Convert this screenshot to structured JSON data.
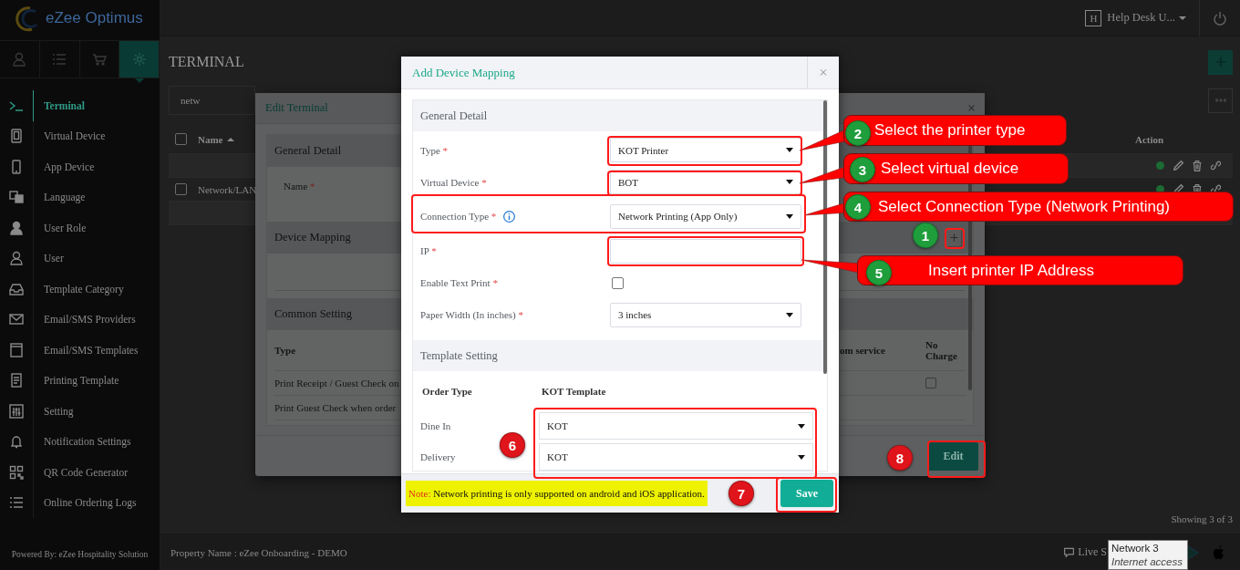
{
  "header": {
    "logo": "eZee Optimus",
    "user_badge": "H",
    "user_name": "Help Desk U..."
  },
  "nav_tabs": [
    {
      "kind": "user",
      "selected": false
    },
    {
      "kind": "list",
      "selected": false
    },
    {
      "kind": "cart",
      "selected": false
    },
    {
      "kind": "gear",
      "selected": true
    }
  ],
  "sidebar": {
    "items": [
      {
        "kind": "terminal",
        "label": "Terminal",
        "selected": true
      },
      {
        "kind": "tablet",
        "label": "Virtual Device",
        "selected": false
      },
      {
        "kind": "phone",
        "label": "App Device",
        "selected": false
      },
      {
        "kind": "language",
        "label": "Language",
        "selected": false
      },
      {
        "kind": "role",
        "label": "User Role",
        "selected": false
      },
      {
        "kind": "user",
        "label": "User",
        "selected": false
      },
      {
        "kind": "tray",
        "label": "Template Category",
        "selected": false
      },
      {
        "kind": "mail",
        "label": "Email/SMS Providers",
        "selected": false
      },
      {
        "kind": "window",
        "label": "Email/SMS Templates",
        "selected": false
      },
      {
        "kind": "doc",
        "label": "Printing Template",
        "selected": false
      },
      {
        "kind": "sliders",
        "label": "Setting",
        "selected": false
      },
      {
        "kind": "bell",
        "label": "Notification Settings",
        "selected": false
      },
      {
        "kind": "qr",
        "label": "QR Code Generator",
        "selected": false
      },
      {
        "kind": "list",
        "label": "Online Ordering Logs",
        "selected": false
      }
    ],
    "footer": "Powered By: eZee Hospitality Solution"
  },
  "page": {
    "title": "TERMINAL",
    "search_value": "netw",
    "select_all_checked": false,
    "columns": [
      "Name",
      "Action"
    ],
    "rows": [
      {
        "kind": "striped",
        "actions": true
      },
      {
        "kind": "text",
        "name": "Network/LAN",
        "checked": false,
        "actions": true
      },
      {
        "kind": "striped"
      }
    ],
    "showing": "Showing 3 of 3"
  },
  "footer": {
    "property": "Property Name : eZee Onboarding - DEMO",
    "live": "Live S"
  },
  "tooltip": {
    "title": "Network 3",
    "subtitle": "Internet access"
  },
  "edit_terminal": {
    "title": "Edit Terminal",
    "close": "×",
    "sections": [
      "General Detail",
      "Device Mapping",
      "Common Setting"
    ],
    "name_label": "Name",
    "name_required_mark": "*",
    "common_columns": [
      "Type",
      "om service",
      "No Charge"
    ],
    "common_rows": [
      {
        "type": "Print Receipt / Guest Check on",
        "no_charge": false
      },
      {
        "type": "Print Guest Check when order"
      }
    ],
    "edit": "Edit"
  },
  "add_device_mapping": {
    "title": "Add Device Mapping",
    "close": "×",
    "general_title": "General Detail",
    "fields": [
      {
        "kind": "select",
        "label": "Type",
        "required_mark": "*",
        "value": "KOT Printer"
      },
      {
        "kind": "select",
        "label": "Virtual Device",
        "required_mark": "*",
        "value": "BOT"
      },
      {
        "kind": "select",
        "label": "Connection Type",
        "required_mark": "*",
        "info": true,
        "value": "Network Printing (App Only)"
      },
      {
        "kind": "text",
        "label": "IP",
        "required_mark": "*"
      },
      {
        "kind": "checkbox",
        "label": "Enable Text Print",
        "required_mark": "*",
        "checked": false
      },
      {
        "kind": "select",
        "label": "Paper Width (In inches)",
        "required_mark": "*",
        "value": "3 inches"
      }
    ],
    "template_title": "Template Setting",
    "template_columns": [
      "Order Type",
      "KOT Template"
    ],
    "templates": [
      {
        "order_type": "Dine In",
        "value": "KOT"
      },
      {
        "order_type": "Delivery",
        "value": "KOT"
      }
    ],
    "note_label": "Note:",
    "note": "Network printing is only supported on android and iOS application.",
    "save": "Save"
  },
  "callouts": [
    {
      "number": "2",
      "text": "Select the printer type"
    },
    {
      "number": "3",
      "text": "Select virtual device"
    },
    {
      "number": "4",
      "text": "Select Connection Type (Network Printing)"
    },
    {
      "number": "5",
      "text": "Insert printer IP Address"
    }
  ],
  "markers": [
    {
      "number": "1",
      "color": "#1f9e3c"
    },
    {
      "number": "6",
      "color": "#e0151b"
    },
    {
      "number": "7",
      "color": "#e0151b"
    },
    {
      "number": "8",
      "color": "#e0151b"
    }
  ]
}
